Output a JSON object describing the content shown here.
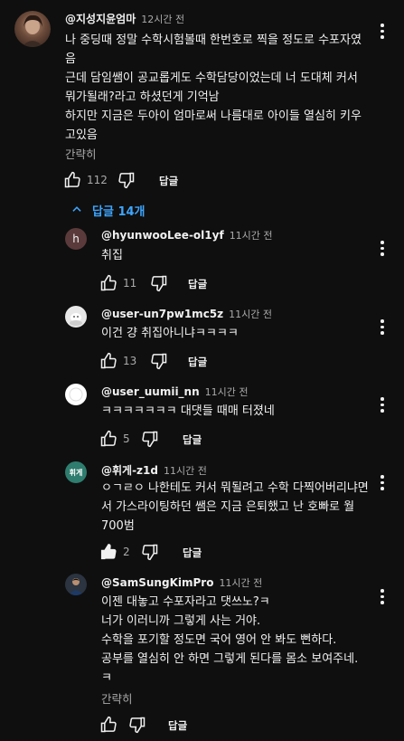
{
  "thread": {
    "top_comment": {
      "author": "@지성지윤엄마",
      "time": "12시간 전",
      "body": "나 중딩때 정말 수학시험볼때 한번호로 찍을 정도로 수포자였음\n근데 담임쌤이 공교롭게도 수학담당이었는데 너 도대체 커서 뭐가될래?라고 하셨던게 기억남\n하지만 지금은 두아이 엄마로써 나름대로 아이들 열심히 키우고있음",
      "collapse_label": "간략히",
      "like_count": "112",
      "reply_label": "답글"
    },
    "replies_toggle": "답글 14개",
    "replies": [
      {
        "author": "@hyunwooLee-ol1yf",
        "time": "11시간 전",
        "avatar_letter": "h",
        "body": "취집",
        "like_count": "11",
        "reply_label": "답글"
      },
      {
        "author": "@user-un7pw1mc5z",
        "time": "11시간 전",
        "avatar_letter": "",
        "body": "이건 걍 취집아니냐ㅋㅋㅋㅋ",
        "like_count": "13",
        "reply_label": "답글"
      },
      {
        "author": "@user_uumii_nn",
        "time": "11시간 전",
        "avatar_letter": "",
        "body": "ㅋㅋㅋㅋㅋㅋㅋ 대댓들 때매 터졌네",
        "like_count": "5",
        "reply_label": "답글"
      },
      {
        "author": "@휘게-z1d",
        "time": "11시간 전",
        "avatar_letter": "휘게",
        "body": "ㅇㄱㄹㅇ 나한테도 커서 뭐될려고 수학 다찍어버리냐면서 가스라이팅하던 쌤은 지금 은퇴했고 난 호빠로 월700범",
        "like_count": "2",
        "reply_label": "답글"
      },
      {
        "author": "@SamSungKimPro",
        "time": "11시간 전",
        "avatar_letter": "",
        "body": "이젠 대놓고 수포자라고 댓쓰노?ㅋ\n너가 이러니까 그렇게 사는 거야.\n수학을 포기할 정도면 국어 영어 안 봐도 뻔하다.\n공부를 열심히 안 하면 그렇게 된다를 몸소 보여주네. ㅋ",
        "collapse_label": "간략히",
        "like_count": "",
        "reply_label": "답글"
      }
    ]
  },
  "colors": {
    "background": "#0f0f0f",
    "text": "#f1f1f1",
    "muted": "#aaaaaa",
    "link": "#3ea6ff",
    "avatar_h": "#5a3a3a",
    "avatar_hwige": "#2e7d6e"
  },
  "icons": [
    "thumb-up-icon",
    "thumb-down-icon",
    "more-vert-icon",
    "chevron-up-icon"
  ]
}
